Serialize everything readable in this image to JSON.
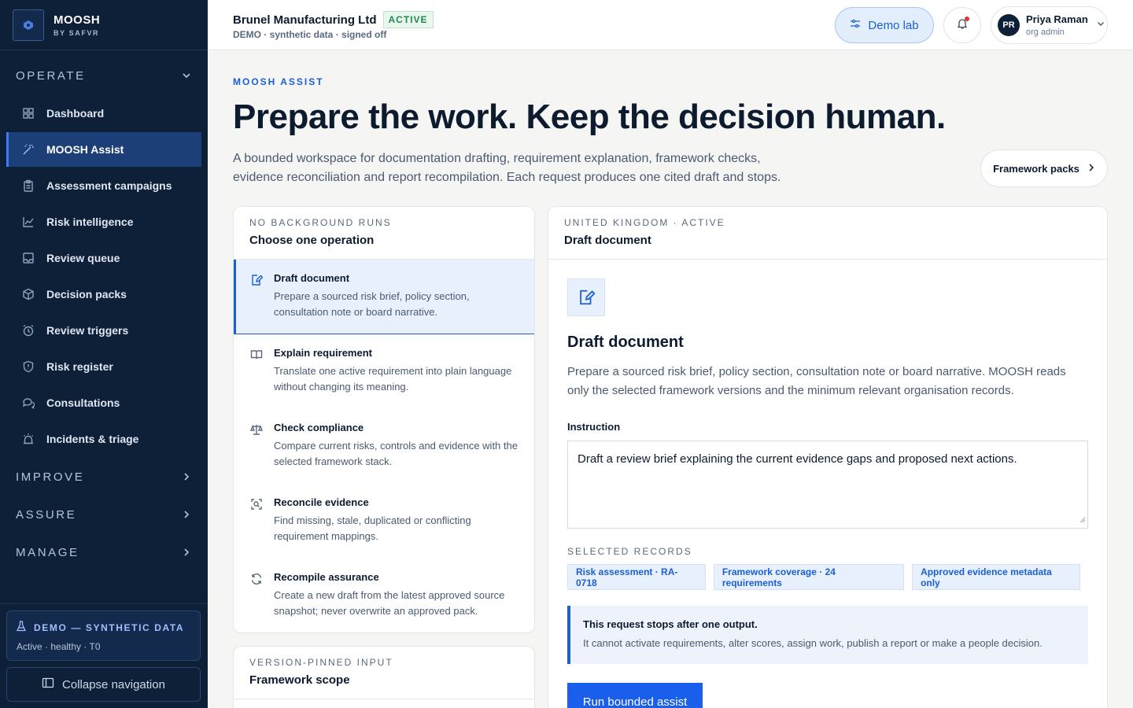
{
  "brand": {
    "name": "MOOSH",
    "sub": "BY SAFVR"
  },
  "sidebar": {
    "operate_label": "OPERATE",
    "items": [
      {
        "label": "Dashboard",
        "icon": "grid-icon"
      },
      {
        "label": "MOOSH Assist",
        "icon": "wand-icon",
        "active": true
      },
      {
        "label": "Assessment campaigns",
        "icon": "clipboard-icon"
      },
      {
        "label": "Risk intelligence",
        "icon": "chart-line-icon"
      },
      {
        "label": "Review queue",
        "icon": "inbox-icon"
      },
      {
        "label": "Decision packs",
        "icon": "package-icon"
      },
      {
        "label": "Review triggers",
        "icon": "alarm-clock-icon"
      },
      {
        "label": "Risk register",
        "icon": "shield-icon"
      },
      {
        "label": "Consultations",
        "icon": "chat-bubbles-icon"
      },
      {
        "label": "Incidents & triage",
        "icon": "siren-icon"
      }
    ],
    "improve_label": "IMPROVE",
    "assure_label": "ASSURE",
    "manage_label": "MANAGE",
    "demo": {
      "title": "DEMO — SYNTHETIC DATA",
      "status": "Active · healthy · T0"
    },
    "collapse_label": "Collapse navigation"
  },
  "topbar": {
    "org_name": "Brunel Manufacturing Ltd",
    "org_status": "ACTIVE",
    "org_sub": "DEMO · synthetic data · signed off",
    "demo_lab": "Demo lab",
    "user": {
      "initials": "PR",
      "name": "Priya Raman",
      "role": "org admin"
    }
  },
  "main": {
    "eyebrow": "MOOSH ASSIST",
    "headline": "Prepare the work. Keep the decision human.",
    "lede": "A bounded workspace for documentation drafting, requirement explanation, framework checks, evidence reconciliation and report recompilation. Each request produces one cited draft and stops.",
    "framework_packs": "Framework packs",
    "ops_card": {
      "eyebrow": "NO BACKGROUND RUNS",
      "title": "Choose one operation",
      "operations": [
        {
          "title": "Draft document",
          "desc": "Prepare a sourced risk brief, policy section, consultation note or board narrative.",
          "icon": "edit-document-icon",
          "active": true
        },
        {
          "title": "Explain requirement",
          "desc": "Translate one active requirement into plain language without changing its meaning.",
          "icon": "open-book-icon"
        },
        {
          "title": "Check compliance",
          "desc": "Compare current risks, controls and evidence with the selected framework stack.",
          "icon": "scales-icon"
        },
        {
          "title": "Reconcile evidence",
          "desc": "Find missing, stale, duplicated or conflicting requirement mappings.",
          "icon": "scan-search-icon"
        },
        {
          "title": "Recompile assurance",
          "desc": "Create a new draft from the latest approved source snapshot; never overwrite an approved pack.",
          "icon": "refresh-icon"
        }
      ]
    },
    "scope_card": {
      "eyebrow": "VERSION-PINNED INPUT",
      "title": "Framework scope"
    },
    "detail_card": {
      "eyebrow": "UNITED KINGDOM · ACTIVE",
      "title": "Draft document",
      "body_title": "Draft document",
      "body_desc": "Prepare a sourced risk brief, policy section, consultation note or board narrative. MOOSH reads only the selected framework versions and the minimum relevant organisation records.",
      "instruction_label": "Instruction",
      "instruction_value": "Draft a review brief explaining the current evidence gaps and proposed next actions.",
      "selected_label": "SELECTED RECORDS",
      "records": [
        "Risk assessment · RA-0718",
        "Framework coverage · 24 requirements",
        "Approved evidence metadata only"
      ],
      "notice_title": "This request stops after one output.",
      "notice_text": "It cannot activate requirements, alter scores, assign work, publish a report or make a people decision.",
      "run_label": "Run bounded assist"
    }
  },
  "colors": {
    "sidebar": "#0e1f38",
    "accent": "#1a5fd6",
    "active_green": "#1e8a4c"
  }
}
